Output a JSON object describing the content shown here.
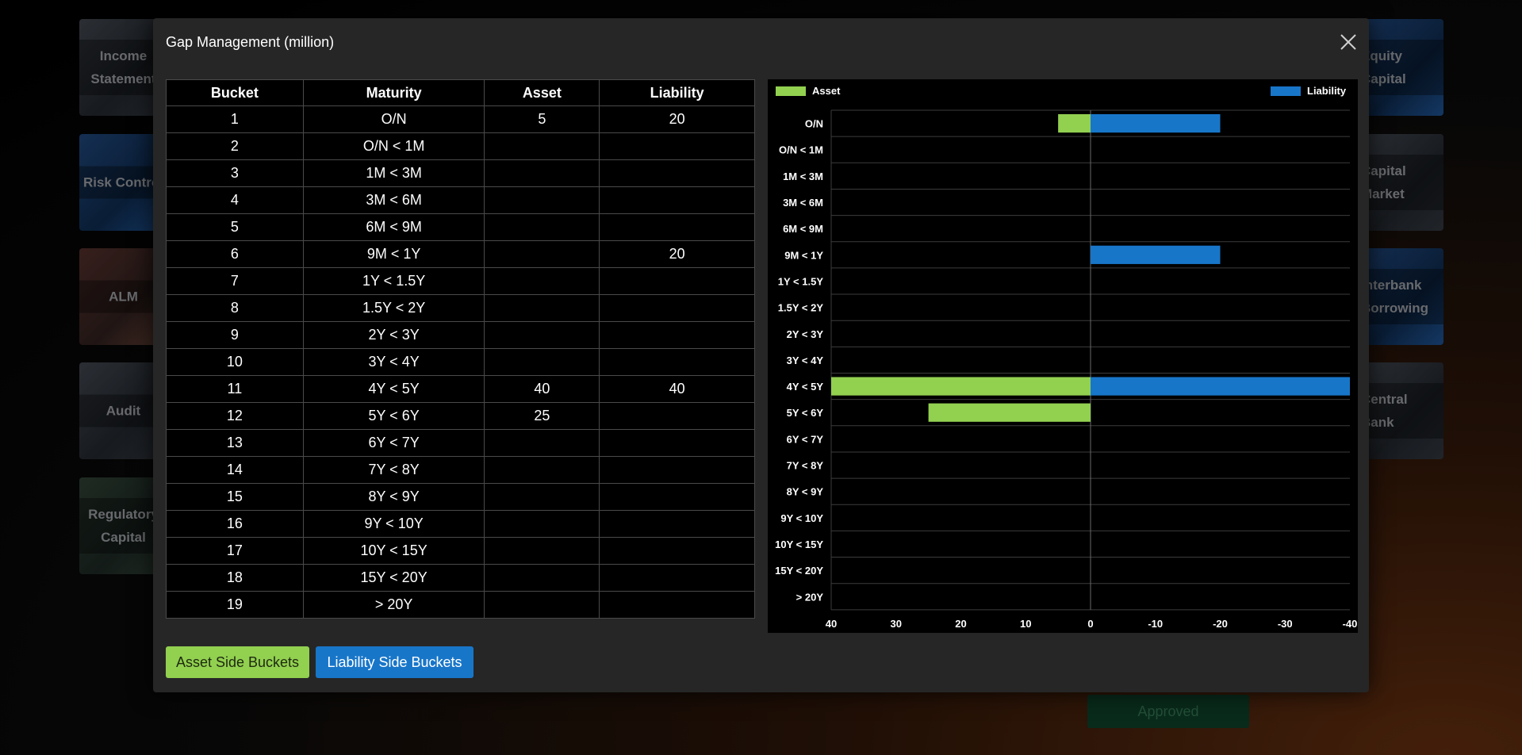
{
  "background": {
    "tiles_left": [
      "Income Statement",
      "Risk Control",
      "ALM",
      "Audit",
      "Regulatory Capital"
    ],
    "tiles_right": [
      "Equity Capital",
      "Capital Market",
      "Interbank Borrowing",
      "Central Bank"
    ],
    "approved_label": "Approved"
  },
  "modal": {
    "title": "Gap Management (million)",
    "close_icon": "close-icon"
  },
  "table": {
    "headers": [
      "Bucket",
      "Maturity",
      "Asset",
      "Liability"
    ],
    "rows": [
      {
        "bucket": "1",
        "maturity": "O/N",
        "asset": "5",
        "liability": "20"
      },
      {
        "bucket": "2",
        "maturity": "O/N < 1M",
        "asset": "",
        "liability": ""
      },
      {
        "bucket": "3",
        "maturity": "1M < 3M",
        "asset": "",
        "liability": ""
      },
      {
        "bucket": "4",
        "maturity": "3M < 6M",
        "asset": "",
        "liability": ""
      },
      {
        "bucket": "5",
        "maturity": "6M < 9M",
        "asset": "",
        "liability": ""
      },
      {
        "bucket": "6",
        "maturity": "9M < 1Y",
        "asset": "",
        "liability": "20"
      },
      {
        "bucket": "7",
        "maturity": "1Y < 1.5Y",
        "asset": "",
        "liability": ""
      },
      {
        "bucket": "8",
        "maturity": "1.5Y < 2Y",
        "asset": "",
        "liability": ""
      },
      {
        "bucket": "9",
        "maturity": "2Y < 3Y",
        "asset": "",
        "liability": ""
      },
      {
        "bucket": "10",
        "maturity": "3Y < 4Y",
        "asset": "",
        "liability": ""
      },
      {
        "bucket": "11",
        "maturity": "4Y < 5Y",
        "asset": "40",
        "liability": "40"
      },
      {
        "bucket": "12",
        "maturity": "5Y < 6Y",
        "asset": "25",
        "liability": ""
      },
      {
        "bucket": "13",
        "maturity": "6Y < 7Y",
        "asset": "",
        "liability": ""
      },
      {
        "bucket": "14",
        "maturity": "7Y < 8Y",
        "asset": "",
        "liability": ""
      },
      {
        "bucket": "15",
        "maturity": "8Y < 9Y",
        "asset": "",
        "liability": ""
      },
      {
        "bucket": "16",
        "maturity": "9Y < 10Y",
        "asset": "",
        "liability": ""
      },
      {
        "bucket": "17",
        "maturity": "10Y < 15Y",
        "asset": "",
        "liability": ""
      },
      {
        "bucket": "18",
        "maturity": "15Y < 20Y",
        "asset": "",
        "liability": ""
      },
      {
        "bucket": "19",
        "maturity": "> 20Y",
        "asset": "",
        "liability": ""
      }
    ]
  },
  "chart_data": {
    "type": "bar",
    "orientation": "horizontal",
    "categories": [
      "O/N",
      "O/N < 1M",
      "1M < 3M",
      "3M < 6M",
      "6M < 9M",
      "9M < 1Y",
      "1Y < 1.5Y",
      "1.5Y < 2Y",
      "2Y < 3Y",
      "3Y < 4Y",
      "4Y < 5Y",
      "5Y < 6Y",
      "6Y < 7Y",
      "7Y < 8Y",
      "8Y < 9Y",
      "9Y < 10Y",
      "10Y < 15Y",
      "15Y < 20Y",
      "> 20Y"
    ],
    "series": [
      {
        "name": "Asset",
        "color": "#92d050",
        "values": [
          5,
          0,
          0,
          0,
          0,
          0,
          0,
          0,
          0,
          0,
          40,
          25,
          0,
          0,
          0,
          0,
          0,
          0,
          0
        ]
      },
      {
        "name": "Liability",
        "color": "#1876c9",
        "values": [
          20,
          0,
          0,
          0,
          0,
          20,
          0,
          0,
          0,
          0,
          40,
          0,
          0,
          0,
          0,
          0,
          0,
          0,
          0
        ]
      }
    ],
    "x_ticks": [
      "40",
      "30",
      "20",
      "10",
      "0",
      "-10",
      "-20",
      "-30",
      "-40"
    ],
    "xlim": [
      40,
      -40
    ],
    "legend": {
      "asset": "Asset",
      "liability": "Liability",
      "placement": "top"
    },
    "grid": true
  },
  "buttons": {
    "asset_label": "Asset Side Buckets",
    "liability_label": "Liability Side Buckets",
    "asset_color": "#92d050",
    "liability_color": "#1876c9"
  }
}
